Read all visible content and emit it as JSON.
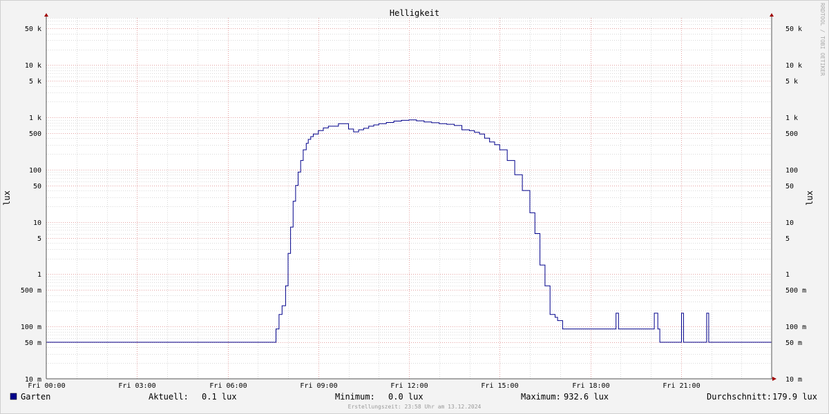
{
  "chart_data": {
    "type": "line",
    "title": "Helligkeit",
    "ylabel": "lux",
    "yscale": "log",
    "ylim": [
      0.01,
      80000
    ],
    "xlim": [
      "Fri 00:00",
      "Sat 00:00"
    ],
    "grid": true,
    "x_ticks": [
      "Fri 00:00",
      "Fri 03:00",
      "Fri 06:00",
      "Fri 09:00",
      "Fri 12:00",
      "Fri 15:00",
      "Fri 18:00",
      "Fri 21:00"
    ],
    "y_ticks": [
      {
        "value": 0.01,
        "label": "10 m"
      },
      {
        "value": 0.05,
        "label": "50 m"
      },
      {
        "value": 0.1,
        "label": "100 m"
      },
      {
        "value": 0.5,
        "label": "500 m"
      },
      {
        "value": 1,
        "label": "1"
      },
      {
        "value": 5,
        "label": "5"
      },
      {
        "value": 10,
        "label": "10"
      },
      {
        "value": 50,
        "label": "50"
      },
      {
        "value": 100,
        "label": "100"
      },
      {
        "value": 500,
        "label": "500"
      },
      {
        "value": 1000,
        "label": "1 k"
      },
      {
        "value": 5000,
        "label": "5 k"
      },
      {
        "value": 10000,
        "label": "10 k"
      },
      {
        "value": 50000,
        "label": "50 k"
      }
    ],
    "series": [
      {
        "name": "Garten",
        "color": "#00008b",
        "x": [
          "Fri 00:00",
          "Fri 07:35",
          "Fri 07:36",
          "Fri 07:41",
          "Fri 07:42",
          "Fri 07:48",
          "Fri 07:55",
          "Fri 08:00",
          "Fri 08:05",
          "Fri 08:10",
          "Fri 08:15",
          "Fri 08:20",
          "Fri 08:25",
          "Fri 08:30",
          "Fri 08:36",
          "Fri 08:40",
          "Fri 08:45",
          "Fri 08:50",
          "Fri 09:00",
          "Fri 09:10",
          "Fri 09:20",
          "Fri 09:40",
          "Fri 10:00",
          "Fri 10:10",
          "Fri 10:20",
          "Fri 10:30",
          "Fri 10:40",
          "Fri 10:50",
          "Fri 11:00",
          "Fri 11:15",
          "Fri 11:30",
          "Fri 11:45",
          "Fri 12:00",
          "Fri 12:15",
          "Fri 12:30",
          "Fri 12:45",
          "Fri 13:00",
          "Fri 13:15",
          "Fri 13:30",
          "Fri 13:45",
          "Fri 14:00",
          "Fri 14:10",
          "Fri 14:20",
          "Fri 14:30",
          "Fri 14:40",
          "Fri 14:50",
          "Fri 15:00",
          "Fri 15:15",
          "Fri 15:30",
          "Fri 15:45",
          "Fri 16:00",
          "Fri 16:10",
          "Fri 16:20",
          "Fri 16:30",
          "Fri 16:40",
          "Fri 16:50",
          "Fri 16:55",
          "Fri 17:00",
          "Fri 17:03",
          "Fri 17:05",
          "Fri 17:10",
          "Fri 17:11",
          "Fri 17:22",
          "Fri 17:23",
          "Fri 18:50",
          "Fri 18:51",
          "Fri 18:55",
          "Fri 18:56",
          "Fri 20:06",
          "Fri 20:07",
          "Fri 20:13",
          "Fri 20:14",
          "Fri 20:18",
          "Fri 20:19",
          "Fri 21:00",
          "Fri 21:01",
          "Fri 21:04",
          "Fri 21:05",
          "Fri 21:50",
          "Fri 21:51",
          "Fri 21:54",
          "Fri 21:55",
          "Sat 00:00"
        ],
        "y": [
          0.05,
          0.05,
          0.09,
          0.09,
          0.17,
          0.25,
          0.6,
          2.5,
          8,
          25,
          50,
          90,
          150,
          240,
          320,
          380,
          430,
          480,
          560,
          630,
          680,
          760,
          600,
          530,
          580,
          620,
          680,
          720,
          760,
          800,
          850,
          880,
          900,
          860,
          820,
          790,
          760,
          740,
          700,
          580,
          560,
          520,
          480,
          400,
          340,
          300,
          240,
          150,
          80,
          40,
          15,
          6,
          1.5,
          0.6,
          0.17,
          0.15,
          0.13,
          0.13,
          0.13,
          0.09,
          0.09,
          0.09,
          0.09,
          0.09,
          0.09,
          0.18,
          0.18,
          0.09,
          0.09,
          0.18,
          0.18,
          0.09,
          0.05,
          0.05,
          0.05,
          0.18,
          0.18,
          0.05,
          0.05,
          0.18,
          0.18,
          0.05,
          0.05
        ]
      }
    ]
  },
  "legend": {
    "series_name": "Garten",
    "swatch_color": "#00008b",
    "aktuell_label": "Aktuell:",
    "aktuell_value": "0.1 lux",
    "minimum_label": "Minimum:",
    "minimum_value": "0.0 lux",
    "maximum_label": "Maximum:",
    "maximum_value": "932.6 lux",
    "durchschnitt_label": "Durchschnitt:",
    "durchschnitt_value": "179.9 lux"
  },
  "footer_text": "Erstellungszeit: 23:58 Uhr am 13.12.2024",
  "watermark_text": "RRDTOOL / TOBI OETIKER"
}
